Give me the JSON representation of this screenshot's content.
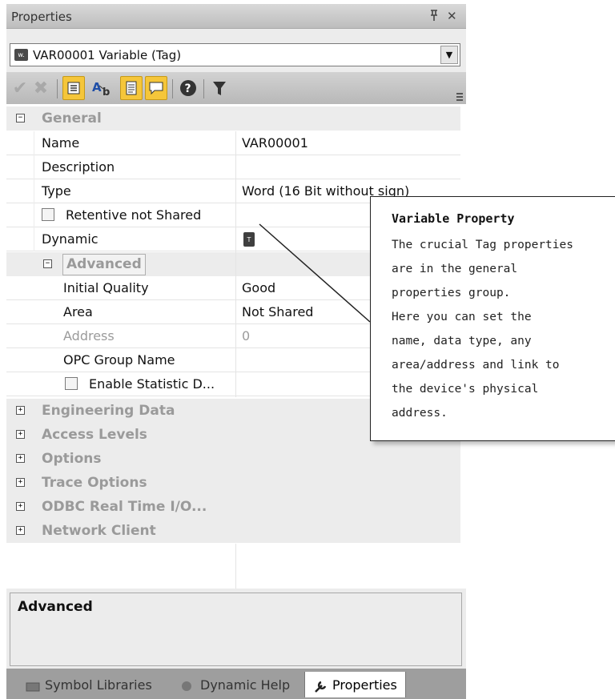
{
  "panel": {
    "title": "Properties",
    "pin_glyph": "ᵖ",
    "close_glyph": "✕"
  },
  "selector": {
    "icon_text": "w.",
    "value": "VAR00001 Variable (Tag)",
    "arrow": "▼"
  },
  "toolbar": {
    "icons": [
      "check-icon",
      "delete-icon",
      "categorized-icon",
      "alphabetical-icon",
      "property-pages-icon",
      "comment-icon",
      "help-icon",
      "filter-icon"
    ]
  },
  "grid": {
    "general": {
      "label": "General",
      "toggle": "−",
      "rows": [
        {
          "name": "Name",
          "value": "VAR00001"
        },
        {
          "name": "Description",
          "value": ""
        },
        {
          "name": "Type",
          "value": "Word (16 Bit without sign)"
        },
        {
          "name": "Retentive not Shared",
          "value": ""
        },
        {
          "name": "Dynamic",
          "value": ""
        }
      ]
    },
    "advanced": {
      "label": "Advanced",
      "toggle": "−",
      "rows": [
        {
          "name": "Initial Quality",
          "value": "Good"
        },
        {
          "name": "Area",
          "value": "Not Shared"
        },
        {
          "name": "Address",
          "value": "0"
        },
        {
          "name": "OPC Group Name",
          "value": ""
        },
        {
          "name": "Enable Statistic D...",
          "value": ""
        }
      ]
    },
    "collapsed": [
      {
        "label": "Engineering Data",
        "toggle": "+"
      },
      {
        "label": "Access Levels",
        "toggle": "+"
      },
      {
        "label": "Options",
        "toggle": "+"
      },
      {
        "label": "Trace Options",
        "toggle": "+"
      },
      {
        "label": "ODBC Real Time I/O...",
        "toggle": "+"
      },
      {
        "label": "Network Client",
        "toggle": "+"
      }
    ]
  },
  "description_pane": {
    "title": "Advanced"
  },
  "tabs": [
    {
      "label": "Symbol Libraries"
    },
    {
      "label": "Dynamic Help"
    },
    {
      "label": "Properties",
      "active": true
    }
  ],
  "tooltip": {
    "title": "Variable Property",
    "lines": [
      "The crucial Tag properties",
      "are in the general",
      "properties group.",
      "Here you can set the",
      "name, data type, any",
      "area/address and link to",
      "the device's physical",
      "address."
    ]
  }
}
